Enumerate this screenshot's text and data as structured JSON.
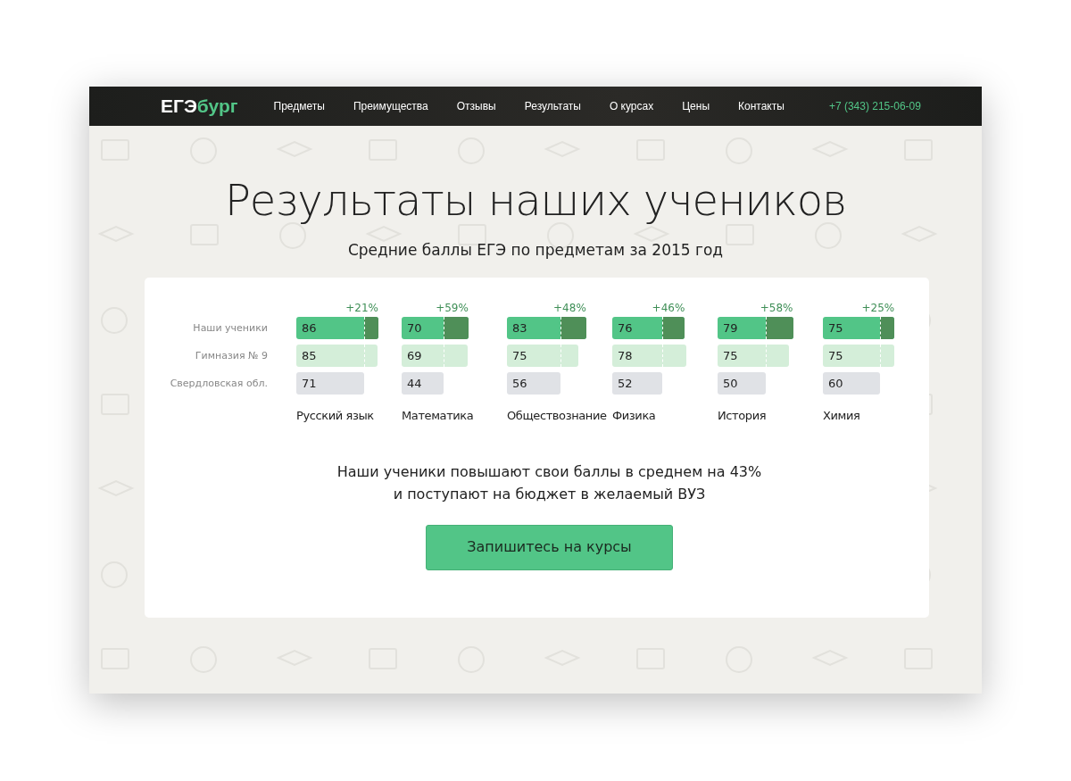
{
  "brand": {
    "part1": "ЕГЭ",
    "part2": "бург"
  },
  "nav": [
    "Предметы",
    "Преимущества",
    "Отзывы",
    "Результаты",
    "О курсах",
    "Цены",
    "Контакты"
  ],
  "phone": "+7 (343) 215-06-09",
  "title": "Результаты наших учеников",
  "subtitle": "Средние баллы ЕГЭ по предметам за 2015 год",
  "row_labels": [
    "Наши ученики",
    "Гимназия № 9",
    "Свердловская обл."
  ],
  "subjects": [
    {
      "name": "Русский язык",
      "gain": "+21%",
      "scores": [
        "86",
        "85",
        "71"
      ]
    },
    {
      "name": "Математика",
      "gain": "+59%",
      "scores": [
        "70",
        "69",
        "44"
      ]
    },
    {
      "name": "Обществознание",
      "gain": "+48%",
      "scores": [
        "83",
        "75",
        "56"
      ]
    },
    {
      "name": "Физика",
      "gain": "+46%",
      "scores": [
        "76",
        "78",
        "52"
      ]
    },
    {
      "name": "История",
      "gain": "+58%",
      "scores": [
        "79",
        "75",
        "50"
      ]
    },
    {
      "name": "Химия",
      "gain": "+25%",
      "scores": [
        "75",
        "75",
        "60"
      ]
    }
  ],
  "summary": [
    "Наши ученики повышают свои баллы в среднем на 43%",
    "и поступают на бюджет в желаемый ВУЗ"
  ],
  "cta": "Запишитесь на курсы"
}
